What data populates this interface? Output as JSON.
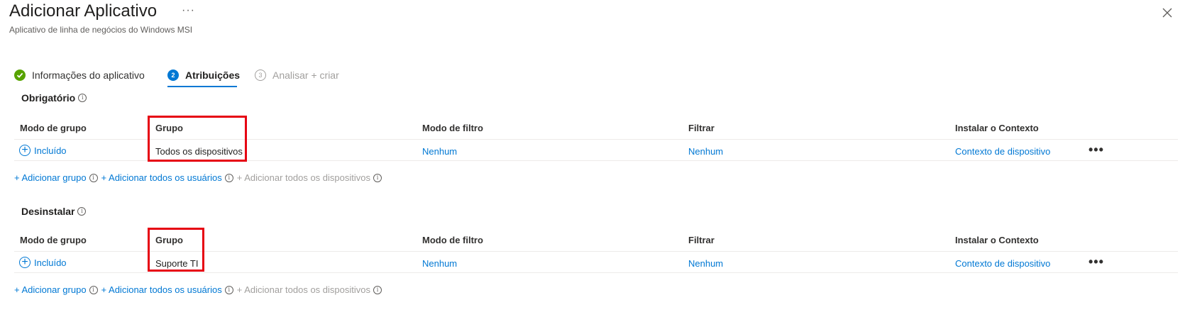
{
  "header": {
    "title": "Adicionar Aplicativo",
    "more": "···",
    "subtitle": "Aplicativo de linha de negócios do Windows MSI"
  },
  "steps": [
    {
      "label": "Informações do aplicativo",
      "state": "done"
    },
    {
      "number": "2",
      "label": "Atribuições",
      "state": "active"
    },
    {
      "number": "3",
      "label": "Analisar + criar",
      "state": "disabled"
    }
  ],
  "required": {
    "title": "Obrigatório",
    "headers": [
      "Modo de grupo",
      "Grupo",
      "Modo de filtro",
      "Filtrar",
      "Instalar o Contexto"
    ],
    "row": {
      "mode": "Incluído",
      "group": "Todos os dispositivos",
      "filter_mode": "Nenhum",
      "filter": "Nenhum",
      "context": "Contexto de dispositivo",
      "more": "•••"
    },
    "actions": {
      "add_group": "+ Adicionar grupo",
      "add_all_users": "+ Adicionar todos os usuários",
      "add_all_devices": "+ Adicionar todos os dispositivos"
    }
  },
  "uninstall": {
    "title": "Desinstalar",
    "headers": [
      "Modo de grupo",
      "Grupo",
      "Modo de filtro",
      "Filtrar",
      "Instalar o Contexto"
    ],
    "row": {
      "mode": "Incluído",
      "group": "Suporte TI",
      "filter_mode": "Nenhum",
      "filter": "Nenhum",
      "context": "Contexto de dispositivo",
      "more": "•••"
    },
    "actions": {
      "add_group": "+ Adicionar grupo",
      "add_all_users": "+ Adicionar todos os usuários",
      "add_all_devices": "+ Adicionar todos os dispositivos"
    }
  },
  "colors": {
    "accent": "#0078d4",
    "success": "#57a300",
    "highlight": "#e60012"
  }
}
